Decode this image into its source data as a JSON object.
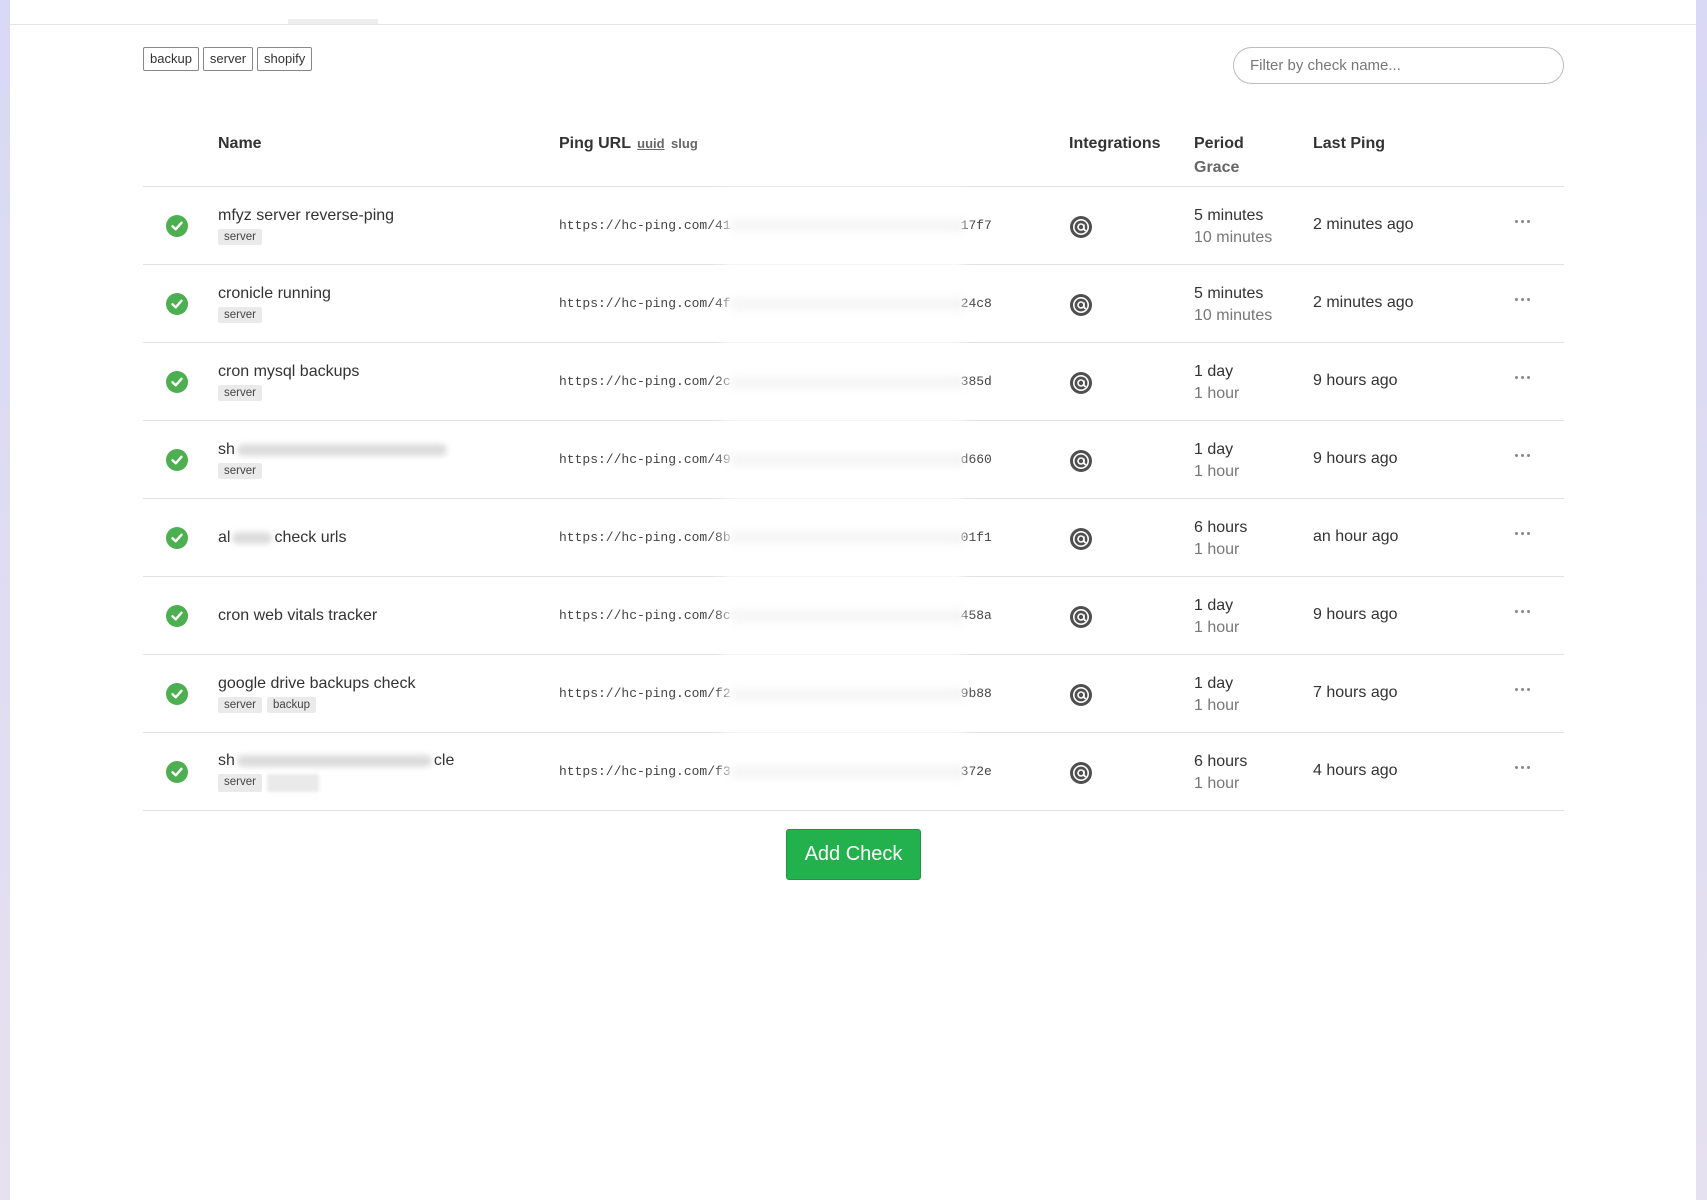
{
  "tag_filter": [
    "backup",
    "server",
    "shopify"
  ],
  "search": {
    "placeholder": "Filter by check name..."
  },
  "table": {
    "headers": {
      "name": "Name",
      "ping_url": "Ping URL",
      "ping_url_uuid": "uuid",
      "ping_url_slug": "slug",
      "integrations": "Integrations",
      "period": "Period",
      "grace": "Grace",
      "last_ping": "Last Ping"
    },
    "rows": [
      {
        "name": "mfyz server reverse-ping",
        "tags": [
          "server"
        ],
        "url_prefix": "https://hc-ping.com/41",
        "url_suffix": "17f7",
        "period": "5 minutes",
        "grace": "10 minutes",
        "last_ping": "2 minutes ago"
      },
      {
        "name": "cronicle running",
        "tags": [
          "server"
        ],
        "url_prefix": "https://hc-ping.com/4f",
        "url_suffix": "24c8",
        "period": "5 minutes",
        "grace": "10 minutes",
        "last_ping": "2 minutes ago"
      },
      {
        "name": "cron mysql backups",
        "tags": [
          "server"
        ],
        "url_prefix": "https://hc-ping.com/2c",
        "url_suffix": "385d",
        "period": "1 day",
        "grace": "1 hour",
        "last_ping": "9 hours ago"
      },
      {
        "name_start": "sh",
        "name_end": "",
        "tags": [
          "server"
        ],
        "url_prefix": "https://hc-ping.com/49",
        "url_suffix": "d660",
        "period": "1 day",
        "grace": "1 hour",
        "last_ping": "9 hours ago"
      },
      {
        "name_start": "al",
        "name_end": "check urls",
        "tags": [],
        "url_prefix": "https://hc-ping.com/8b",
        "url_suffix": "01f1",
        "period": "6 hours",
        "grace": "1 hour",
        "last_ping": "an hour ago"
      },
      {
        "name": "cron web vitals tracker",
        "tags": [],
        "url_prefix": "https://hc-ping.com/8c",
        "url_suffix": "458a",
        "period": "1 day",
        "grace": "1 hour",
        "last_ping": "9 hours ago"
      },
      {
        "name": "google drive backups check",
        "tags": [
          "server",
          "backup"
        ],
        "url_prefix": "https://hc-ping.com/f2",
        "url_suffix": "9b88",
        "period": "1 day",
        "grace": "1 hour",
        "last_ping": "7 hours ago"
      },
      {
        "name_start": "sh",
        "name_end": "cle",
        "tags": [
          "server"
        ],
        "url_prefix": "https://hc-ping.com/f3",
        "url_suffix": "372e",
        "period": "6 hours",
        "grace": "1 hour",
        "last_ping": "4 hours ago"
      }
    ]
  },
  "add_check_label": "Add Check",
  "icons": {
    "status": "check-circle-icon",
    "integration": "at-sign-icon",
    "menu": "more-horizontal-icon"
  },
  "colors": {
    "status_up": "#4caf50",
    "add_check_bg": "#22b14c"
  }
}
